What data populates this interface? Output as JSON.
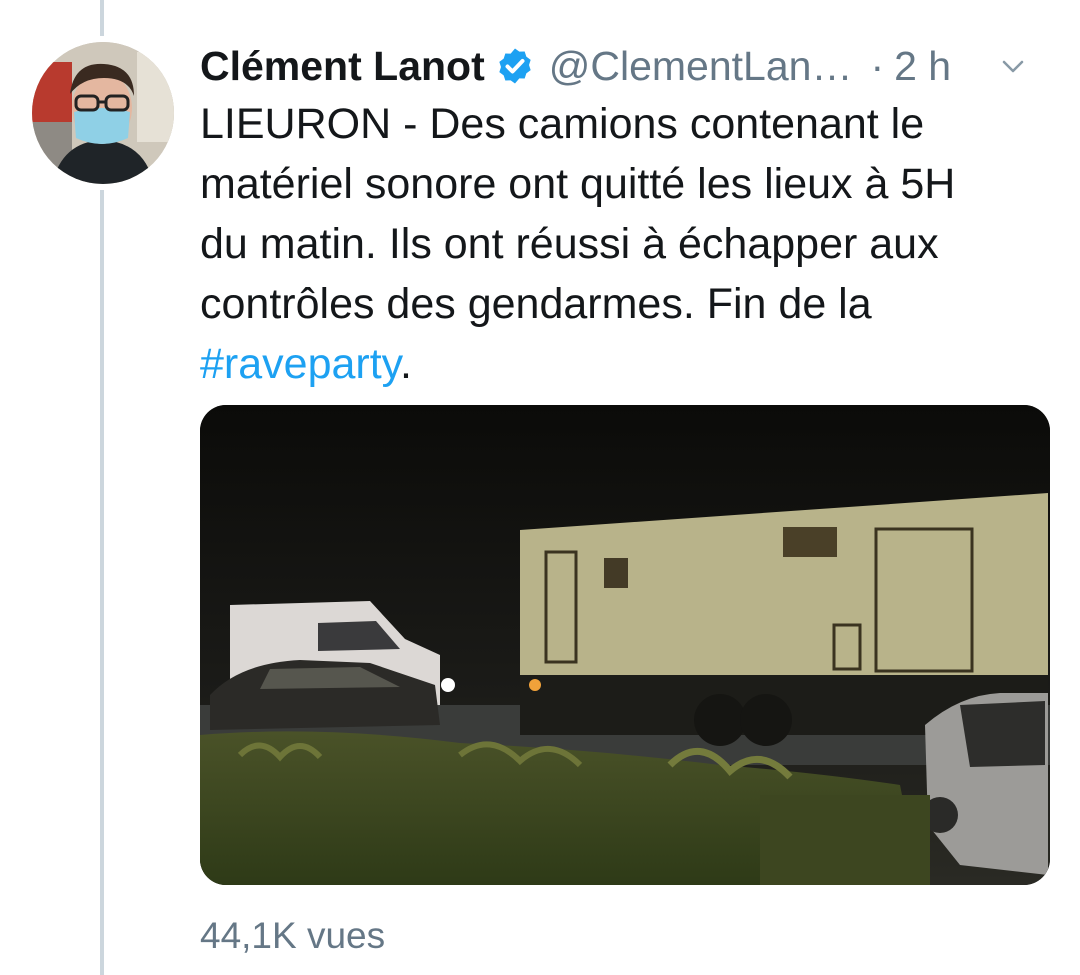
{
  "tweet": {
    "author": {
      "name": "Clément Lanot",
      "handle": "@ClementLan…",
      "verified": true,
      "avatar_icon": "profile-photo"
    },
    "separator": "·",
    "timestamp": "2 h",
    "menu_icon": "chevron-down-icon",
    "text_lines": [
      "LIEURON - Des camions contenant le",
      "matériel sonore ont quitté les lieux à 5H",
      "du matin. Ils ont réussi à échapper aux",
      "contrôles des gendarmes. Fin de la"
    ],
    "hashtag": "#raveparty",
    "text_end": ".",
    "views": "44,1K vues"
  },
  "colors": {
    "text": "#14171a",
    "secondary": "#657786",
    "link": "#1da1f2",
    "verified": "#1da1f2",
    "thread_line": "#ccd6dd"
  }
}
